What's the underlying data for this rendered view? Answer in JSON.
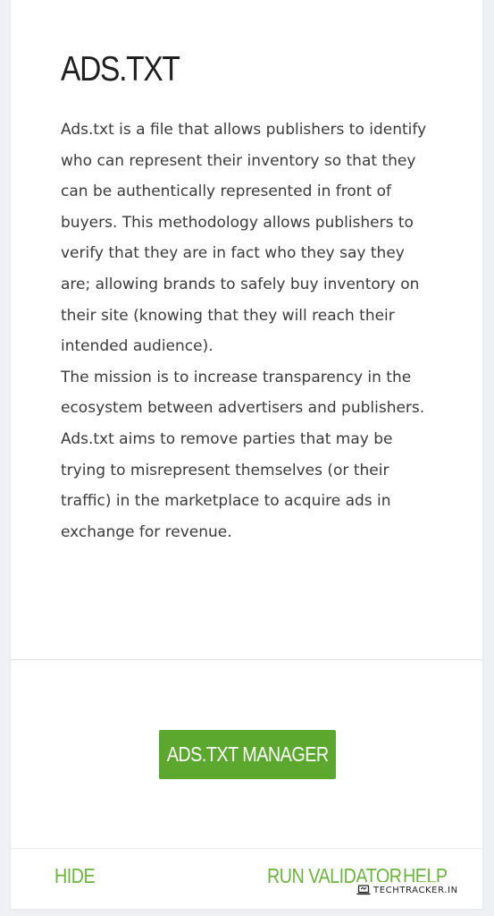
{
  "card": {
    "title": "ADS.TXT",
    "paragraphs": [
      "Ads.txt is a file that allows publishers to identify who can represent their inventory so that they can be authentically represented in front of buyers. This methodology allows publishers to verify that they are in fact who they say they are; allowing brands to safely buy inventory on their site (knowing that they will reach their intended audience).",
      "The mission is to increase transparency in the ecosystem between advertisers and publishers. Ads.txt aims to remove parties that may be trying to misrepresent themselves (or their traffic) in the marketplace to acquire ads in exchange for revenue."
    ],
    "primary_button_label": "ADS.TXT MANAGER"
  },
  "footer": {
    "hide_label": "HIDE",
    "run_validator_label": "RUN VALIDATOR",
    "help_label": "HELP"
  },
  "watermark": {
    "text": "TECHTRACKER.IN",
    "icon": "laptop-icon"
  },
  "colors": {
    "accent": "#5ca82e",
    "link": "#6db33f",
    "text": "#3b3b3b",
    "background": "#eef0f3"
  }
}
